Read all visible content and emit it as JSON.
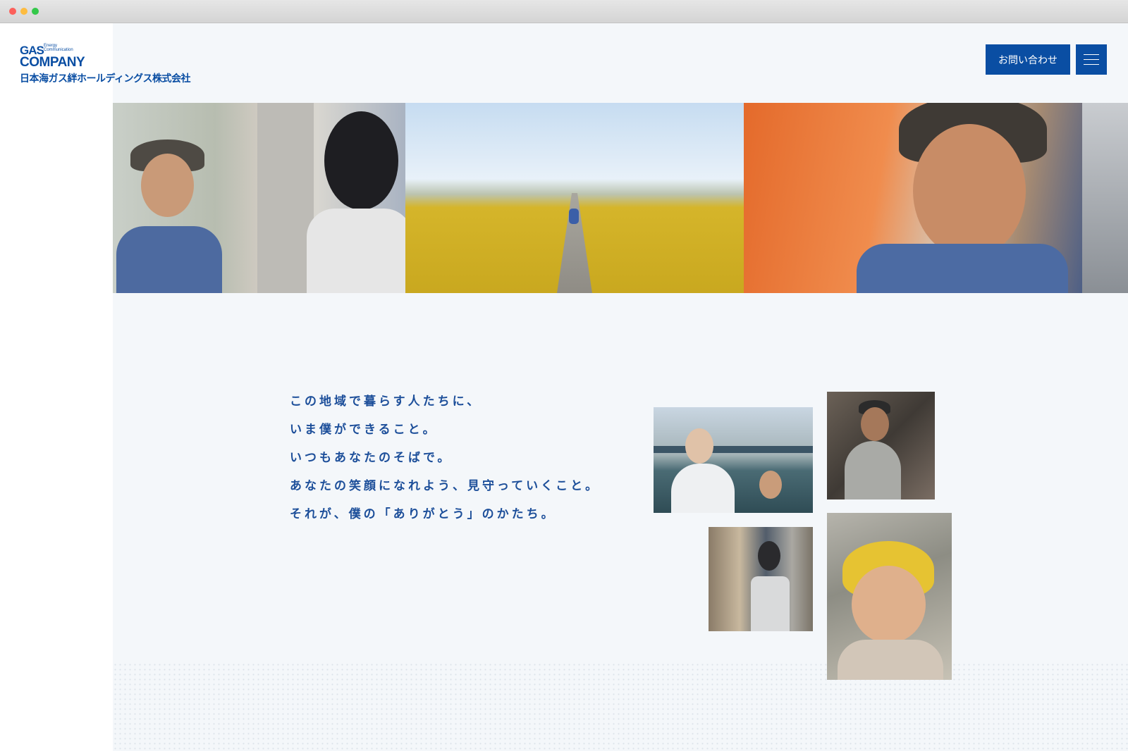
{
  "window": {
    "title": ""
  },
  "logo": {
    "gas": "GAS",
    "tagline_1": "Energy",
    "tagline_2": "Communication",
    "company": "COMPANY",
    "name": "日本海ガス絆ホールディングス株式会社"
  },
  "header": {
    "contact_label": "お問い合わせ",
    "menu_icon": "hamburger-menu-icon"
  },
  "hero": {
    "frames": [
      "hero-photo-1",
      "hero-photo-2",
      "hero-photo-3",
      "hero-photo-4"
    ]
  },
  "message": {
    "lines": [
      "この地域で暮らす人たちに、",
      "いま僕ができること。",
      "いつもあなたのそばで。",
      "あなたの笑顔になれよう、見守っていくこと。",
      "それが、僕の「ありがとう」のかたち。"
    ]
  },
  "colors": {
    "brand": "#0a4ea3",
    "text": "#1d4f9a",
    "background": "#f4f7fa"
  }
}
